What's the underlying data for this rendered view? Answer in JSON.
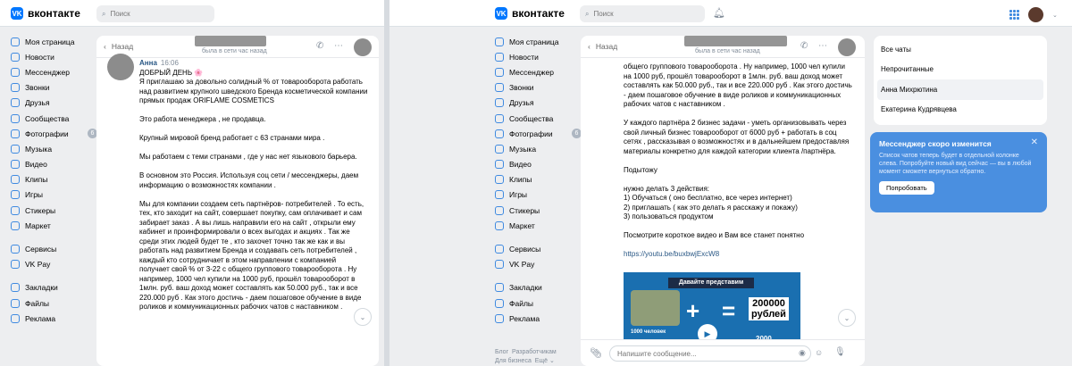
{
  "brand": {
    "name": "вконтакте",
    "mark": "VK"
  },
  "search": {
    "placeholder": "Поиск"
  },
  "nav": {
    "items": [
      {
        "label": "Моя страница",
        "icon": "user-icon"
      },
      {
        "label": "Новости",
        "icon": "news-icon"
      },
      {
        "label": "Мессенджер",
        "icon": "messenger-icon"
      },
      {
        "label": "Звонки",
        "icon": "phone-icon"
      },
      {
        "label": "Друзья",
        "icon": "friends-icon"
      },
      {
        "label": "Сообщества",
        "icon": "communities-icon"
      },
      {
        "label": "Фотографии",
        "icon": "photos-icon",
        "badge": "6"
      },
      {
        "label": "Музыка",
        "icon": "music-icon"
      },
      {
        "label": "Видео",
        "icon": "video-icon"
      },
      {
        "label": "Клипы",
        "icon": "clips-icon"
      },
      {
        "label": "Игры",
        "icon": "games-icon"
      },
      {
        "label": "Стикеры",
        "icon": "stickers-icon"
      },
      {
        "label": "Маркет",
        "icon": "market-icon"
      }
    ],
    "services": [
      {
        "label": "Сервисы",
        "icon": "services-icon"
      },
      {
        "label": "VK Pay",
        "icon": "vkpay-icon"
      }
    ],
    "extra": [
      {
        "label": "Закладки",
        "icon": "bookmarks-icon"
      },
      {
        "label": "Файлы",
        "icon": "files-icon"
      },
      {
        "label": "Реклама",
        "icon": "ads-icon"
      }
    ],
    "footer": {
      "blog": "Блог",
      "devs": "Разработчикам",
      "biz": "Для бизнеса",
      "more": "Ещё ⌄"
    }
  },
  "chat": {
    "back": "Назад",
    "status": "была в сети час назад",
    "status_right": "была в сети час назад",
    "author": "Анна",
    "time": "16:06",
    "left_paragraphs": [
      "ДОБРЫЙ ДЕНЬ 🌸\nЯ приглашаю за довольно солидный % от товарооборота работать над развитием крупного шведского Бренда косметической компании прямых продаж ORIFLAME COSMETICS",
      "Это работа менеджера , не продавца.",
      "Крупный мировой бренд работает с 63 странами мира .",
      "Мы работаем с теми странами , где у нас нет языкового барьера.",
      "В основном это Россия. Используя соц сети / мессенджеры, даем информацию о возможностях компании .",
      "Мы для компании создаем сеть партнёров- потребителей . То есть, тех, кто заходит на сайт, совершает покупку, сам оплачивает и сам забирает заказ . А вы лишь направили его на сайт , открыли ему кабинет и проинформировали о всех выгодах и акциях . Так же среди этих людей будет те , кто захочет точно так же как и вы работать над развитием Бренда и создавать сеть потребителей , каждый кто сотрудничает в этом направлении с компанией получает свой % от 3-22 с общего группового товарооборота . Ну например, 1000 чел купили на 1000 руб, прошёл товарооборот в 1млн. руб. ваш доход может составлять как 50.000 руб., так и все 220.000 руб . Как этого достичь - даем пошаговое обучение в виде роликов и коммуникационных рабочих чатов с наставником ."
    ],
    "right_paragraphs": [
      "общего группового товарооборота . Ну например, 1000 чел купили на 1000 руб, прошёл товарооборот в 1млн. руб. ваш доход может составлять как 50.000 руб., так и все 220.000 руб . Как этого достичь - даем пошаговое обучение в виде роликов и коммуникационных рабочих чатов с наставником .",
      "У каждого партнёра 2 бизнес задачи - уметь организовывать через свой личный бизнес товарооборот от 6000 руб + работать в соц сетях , рассказывая о возможностях и в дальнейшем предоставляя материалы конкретно для каждой категории клиента /партнёра.",
      "Подытожу",
      "нужно делать 3 действия:\n1) Обучаться ( оно бесплатно, все через интернет)\n2) приглашать ( как это делать я расскажу и покажу)\n3) пользоваться продуктом",
      "Посмотрите короткое видео и Вам все станет понятно"
    ],
    "link": "https://youtu.be/buxbwjExcW8",
    "video": {
      "banner": "Давайте представим",
      "number": "200000\nрублей",
      "caption": "1000 человек",
      "year": "2000"
    },
    "composer_placeholder": "Напишите сообщение..."
  },
  "sidebar": {
    "items": [
      "Все чаты",
      "Непрочитанные",
      "Анна Михрютина",
      "Екатерина Кудрявцева"
    ],
    "active": 2
  },
  "promo": {
    "title": "Мессенджер скоро изменится",
    "text": "Список чатов теперь будет в отдельной колонке слева. Попробуйте новый вид сейчас — вы в любой момент сможете вернуться обратно.",
    "button": "Попробовать"
  },
  "colors": {
    "accent": "#0077ff",
    "link": "#2a5885",
    "promo": "#4a8fe0"
  }
}
